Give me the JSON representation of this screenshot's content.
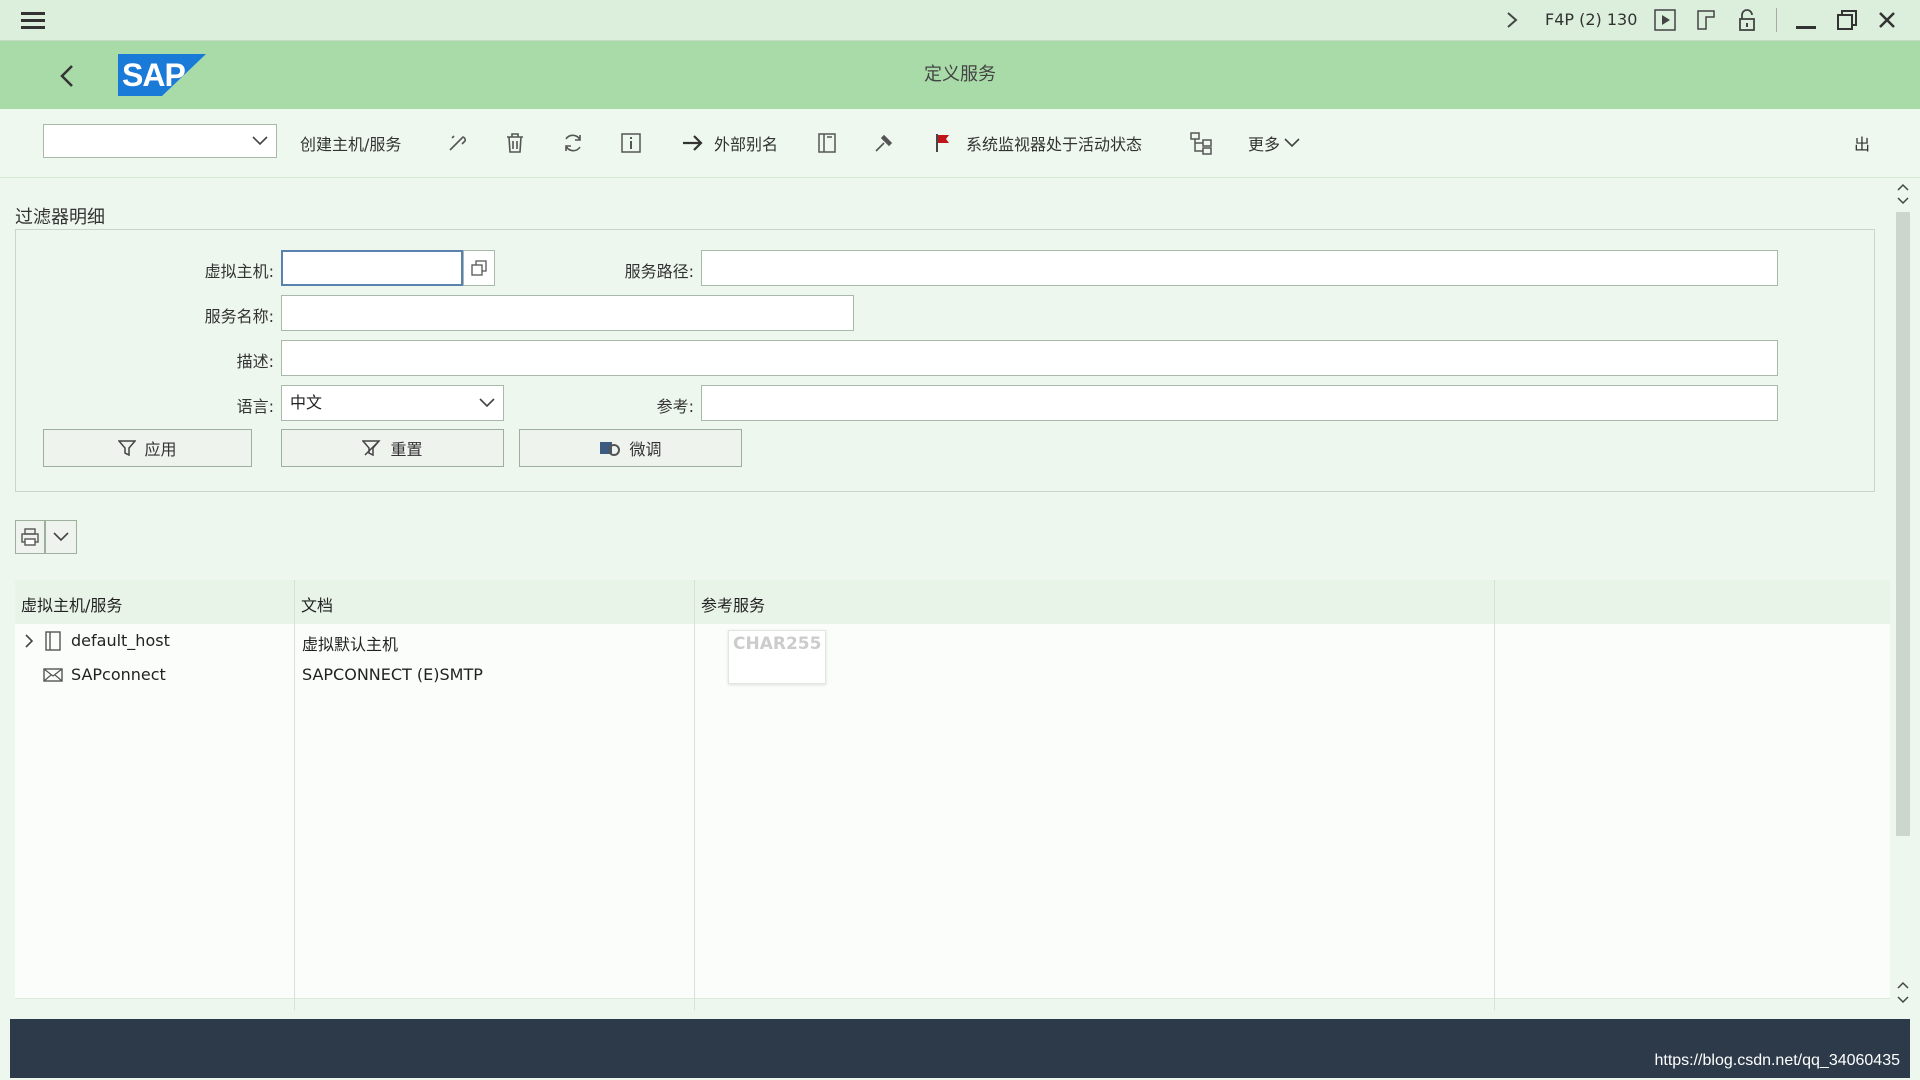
{
  "system": {
    "session": "F4P (2) 130"
  },
  "header": {
    "title": "定义服务",
    "logo_text": "SAP"
  },
  "toolbar": {
    "dropdown_value": "",
    "create_host_service": "创建主机/服务",
    "external_alias": "外部别名",
    "system_monitor": "系统监视器处于活动状态",
    "more": "更多",
    "exit": "出"
  },
  "filter": {
    "section_title": "过滤器明细",
    "virtual_host_label": "虚拟主机:",
    "virtual_host_value": "",
    "service_path_label": "服务路径:",
    "service_path_value": "",
    "service_name_label": "服务名称:",
    "service_name_value": "",
    "description_label": "描述:",
    "description_value": "",
    "language_label": "语言:",
    "language_value": "中文",
    "reference_label": "参考:",
    "reference_value": "",
    "apply_button": "应用",
    "reset_button": "重置",
    "fine_tune_button": "微调"
  },
  "grid": {
    "columns": [
      "虚拟主机/服务",
      "文档",
      "参考服务",
      ""
    ],
    "rows": [
      {
        "name": "default_host",
        "doc": "虚拟默认主机",
        "ref": ""
      },
      {
        "name": "SAPconnect",
        "doc": "SAPCONNECT (E)SMTP",
        "ref": ""
      }
    ],
    "tooltip": "CHAR255"
  },
  "status": {
    "watermark": "https://blog.csdn.net/qq_34060435"
  },
  "colors": {
    "title_bar": "#a9dba9",
    "top_bar": "#dcefdc",
    "background": "#eef7ee",
    "status_bar": "#2c3a4a",
    "logo_blue": "#1a7ad8"
  }
}
